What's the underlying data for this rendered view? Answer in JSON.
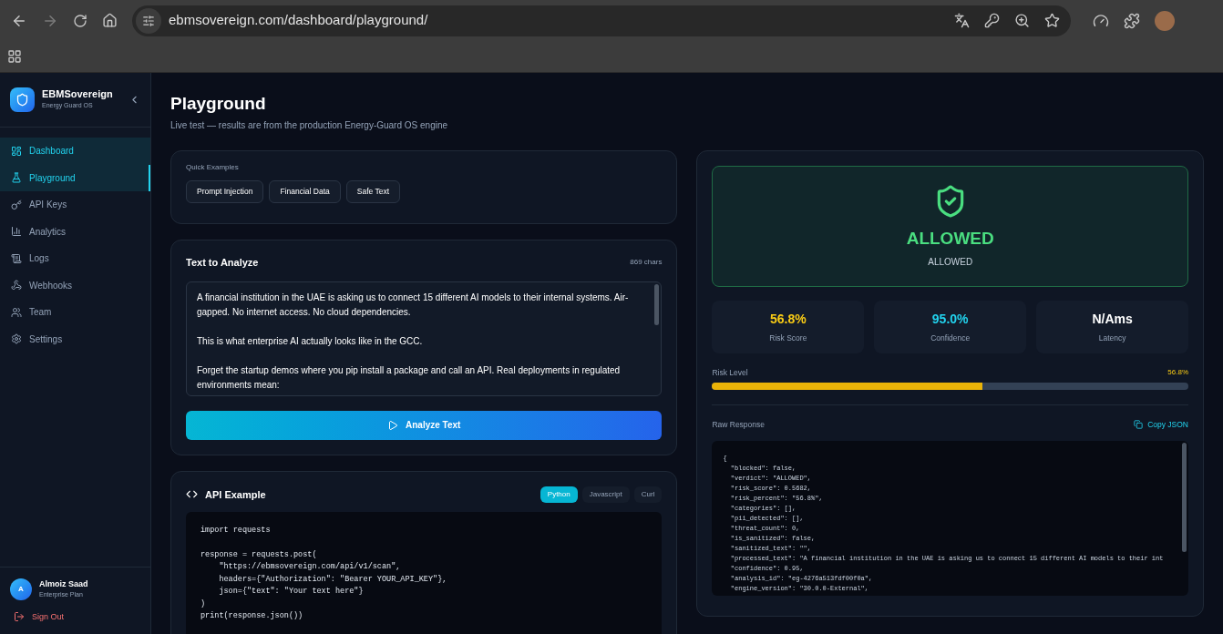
{
  "browser": {
    "url": "ebmsovereign.com/dashboard/playground/"
  },
  "sidebar": {
    "brand": "EBMSovereign",
    "subtitle": "Energy Guard OS",
    "items": [
      {
        "kind": "dashboard",
        "label": "Dashboard",
        "selected": true,
        "current": false
      },
      {
        "kind": "playground",
        "label": "Playground",
        "selected": true,
        "current": true
      },
      {
        "kind": "keys",
        "label": "API Keys",
        "selected": false,
        "current": false
      },
      {
        "kind": "analytics",
        "label": "Analytics",
        "selected": false,
        "current": false
      },
      {
        "kind": "logs",
        "label": "Logs",
        "selected": false,
        "current": false
      },
      {
        "kind": "webhooks",
        "label": "Webhooks",
        "selected": false,
        "current": false
      },
      {
        "kind": "team",
        "label": "Team",
        "selected": false,
        "current": false
      },
      {
        "kind": "settings",
        "label": "Settings",
        "selected": false,
        "current": false
      }
    ],
    "user": {
      "initial": "A",
      "name": "Almoiz Saad",
      "plan": "Enterprise Plan"
    },
    "sign_out": "Sign Out"
  },
  "page": {
    "title": "Playground",
    "subtitle": "Live test — results are from the production Energy-Guard OS engine"
  },
  "quick_examples": {
    "title": "Quick Examples",
    "buttons": [
      "Prompt Injection",
      "Financial Data",
      "Safe Text"
    ]
  },
  "analyze": {
    "title": "Text to Analyze",
    "count": "869 chars",
    "paragraphs": [
      "A financial institution in the UAE is asking us to connect 15 different AI models to their internal systems. Air-gapped. No internet access. No cloud dependencies.",
      "This is what enterprise AI actually looks like in the GCC.",
      "Forget the startup demos where you pip install a package and call an API. Real deployments in regulated environments mean:"
    ],
    "button": "Analyze Text"
  },
  "api_example": {
    "title": "API Example",
    "tabs": [
      {
        "label": "Python",
        "selected": true
      },
      {
        "label": "Javascript",
        "selected": false
      },
      {
        "label": "Curl",
        "selected": false
      }
    ],
    "code_blocks": [
      [
        "import requests"
      ],
      [
        "response = requests.post(",
        "    \"https://ebmsovereign.com/api/v1/scan\",",
        "    headers={\"Authorization\": \"Bearer YOUR_API_KEY\"},",
        "    json={\"text\": \"Your text here\"}",
        ")",
        "print(response.json())"
      ]
    ]
  },
  "result": {
    "verdict": "ALLOWED",
    "verdict_sub": "ALLOWED",
    "stats": [
      {
        "value": "56.8%",
        "label": "Risk Score",
        "color": "#facc15"
      },
      {
        "value": "95.0%",
        "label": "Confidence",
        "color": "#22d3ee"
      },
      {
        "value": "N/Ams",
        "label": "Latency",
        "color": "#ffffff"
      }
    ],
    "risk_label": "Risk Level",
    "risk_value": "56.8%",
    "level": 0.568,
    "raw_title": "Raw Response",
    "copy": "Copy JSON",
    "raw_lines": [
      "{",
      "  \"blocked\": false,",
      "  \"verdict\": \"ALLOWED\",",
      "  \"risk_score\": 0.5682,",
      "  \"risk_percent\": \"56.8%\",",
      "  \"categories\": [],",
      "  \"pii_detected\": [],",
      "  \"threat_count\": 0,",
      "  \"is_sanitized\": false,",
      "  \"sanitized_text\": \"\",",
      "  \"processed_text\": \"A financial institution in the UAE is asking us to connect 15 different AI models to their int",
      "  \"confidence\": 0.95,",
      "  \"analysis_id\": \"eg-4276a513fdf00f0a\",",
      "  \"engine_version\": \"30.0.0-External\","
    ]
  }
}
